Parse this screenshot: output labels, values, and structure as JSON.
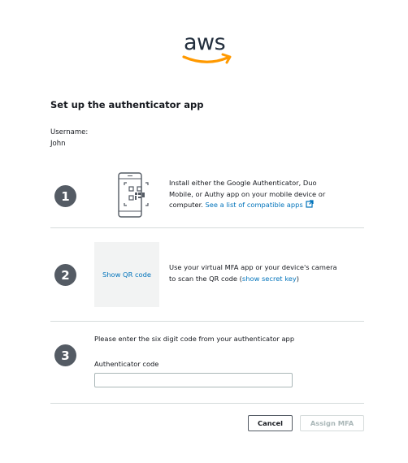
{
  "brand": {
    "logo_text": "aws",
    "smile_color": "#ff9900"
  },
  "page": {
    "title": "Set up the authenticator app"
  },
  "user": {
    "label": "Username:",
    "value": "John"
  },
  "steps": [
    {
      "number": "1",
      "text_prefix": "Install either the Google Authenticator, Duo Mobile, or Authy app on your mobile device or computer.",
      "link_text": "See a list of compatible apps",
      "icon": "phone-qr-icon"
    },
    {
      "number": "2",
      "qr_button_label": "Show QR code",
      "text_prefix": "Use your virtual MFA app or your device's camera to scan the QR code (",
      "link_text": "show secret key",
      "text_suffix": ")"
    },
    {
      "number": "3",
      "instruction": "Please enter the six digit code from your authenticator app",
      "code_label": "Authenticator code",
      "code_value": ""
    }
  ],
  "buttons": {
    "cancel": "Cancel",
    "assign": "Assign MFA"
  },
  "colors": {
    "link": "#0073bb",
    "step_circle": "#545b64",
    "divider": "#d5dbdb"
  }
}
